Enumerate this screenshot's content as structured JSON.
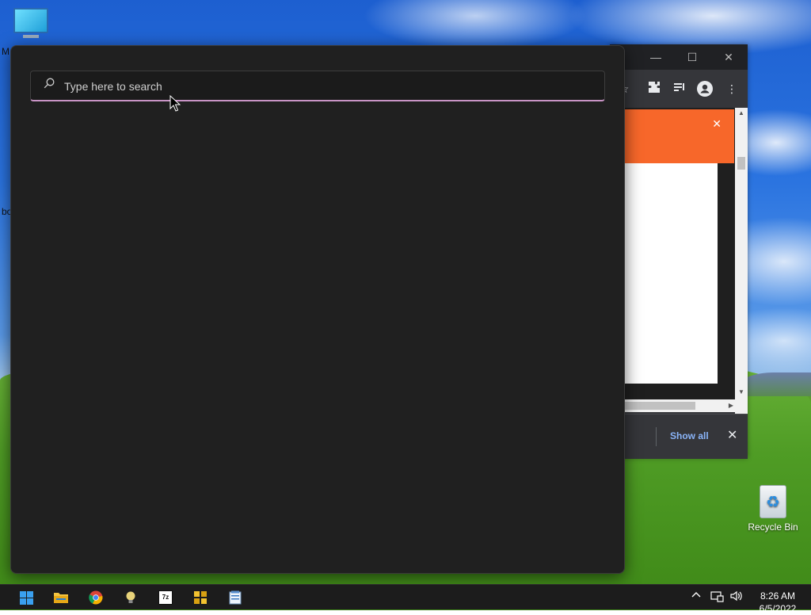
{
  "desktop": {
    "icons": [
      {
        "name": "This PC",
        "label": ""
      },
      {
        "name": "Recycle Bin",
        "label": "Recycle Bin"
      }
    ],
    "left_edge_fragments": [
      "M",
      "bo"
    ]
  },
  "search": {
    "placeholder": "Type here to search",
    "value": ""
  },
  "chrome": {
    "window_controls": [
      "minimize-icon",
      "maximize-icon",
      "close-icon"
    ],
    "toolbar_icons": [
      "star-icon",
      "extensions-icon",
      "reading-list-icon",
      "profile-icon",
      "menu-icon"
    ],
    "banner_color": "#f7672a",
    "download_bar": {
      "show_all_label": "Show all"
    }
  },
  "taskbar": {
    "apps": [
      "start-icon",
      "file-explorer-icon",
      "chrome-icon",
      "lightbulb-app-icon",
      "7zip-icon",
      "puzzle-app-icon",
      "notepad-app-icon"
    ],
    "tray_icons": [
      "chevron-up-icon",
      "network-icon",
      "volume-icon"
    ],
    "clock": {
      "time": "8:26 AM",
      "date": "6/5/2022"
    }
  },
  "colors": {
    "search_accent": "#c994c6",
    "panel_bg": "#202020",
    "taskbar_bg": "#1c1c1c"
  }
}
